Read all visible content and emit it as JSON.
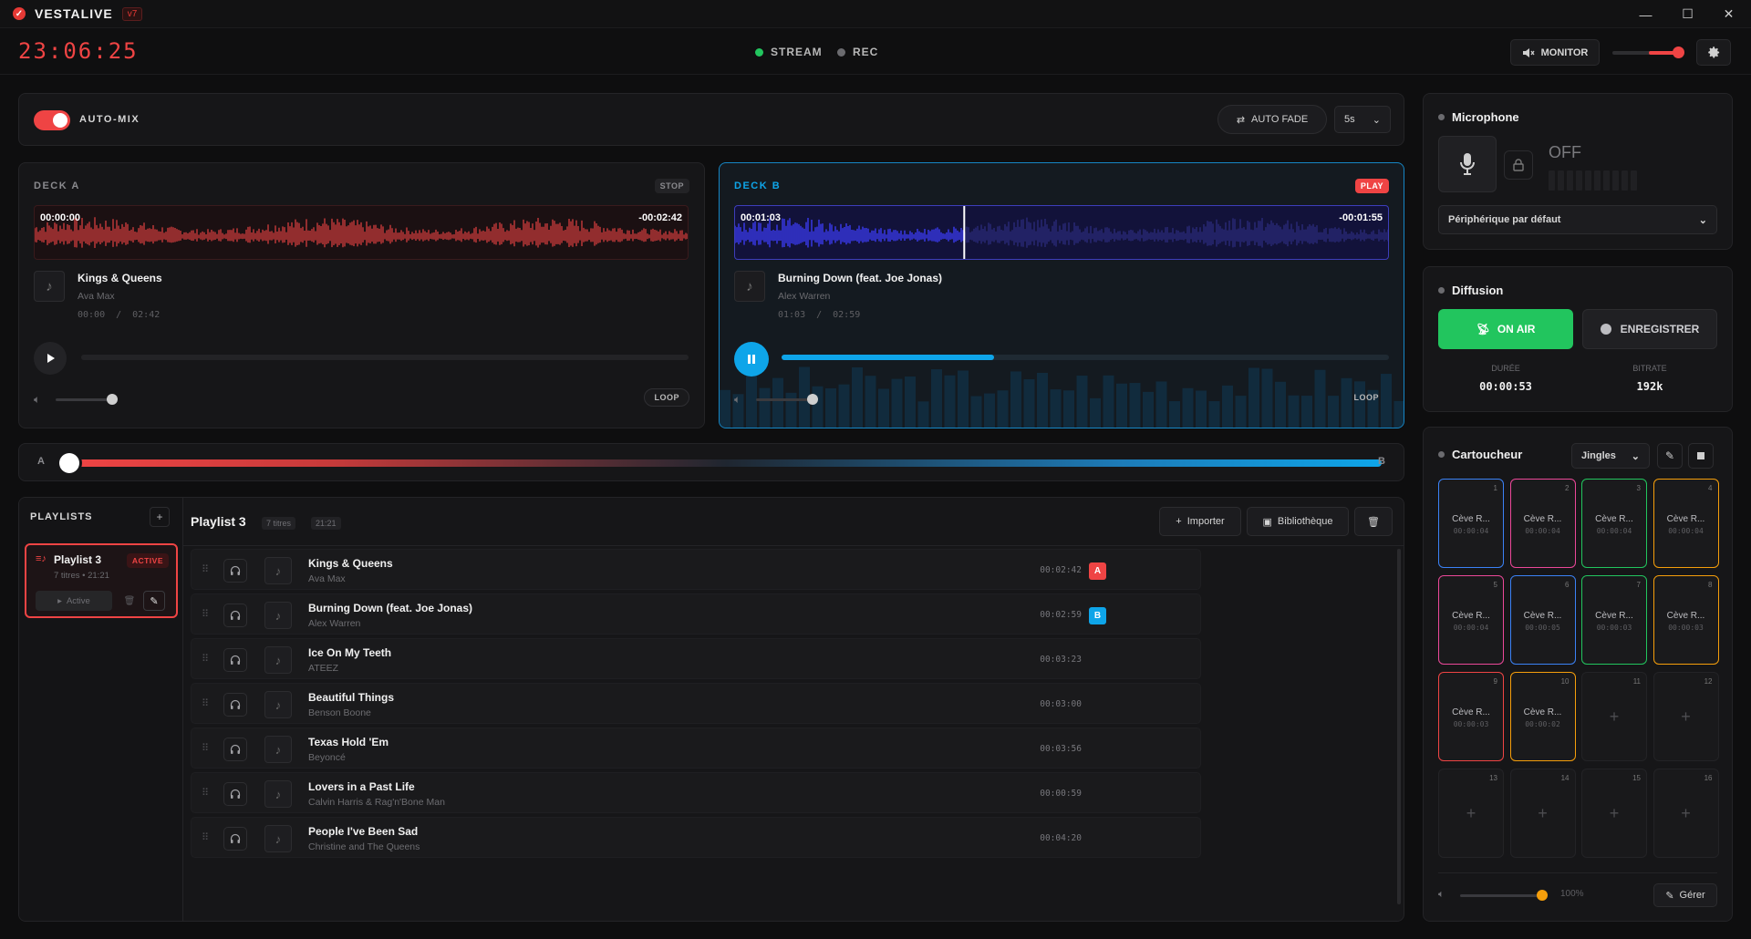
{
  "app": {
    "brand": "VESTALIVE",
    "version": "v7"
  },
  "window": {
    "minimize": "—",
    "maximize": "☐",
    "close": "✕"
  },
  "header": {
    "clock": "23:06:25",
    "stream_label": "STREAM",
    "rec_label": "REC",
    "monitor_label": "MONITOR",
    "monitor_volume": 0.85,
    "colors": {
      "stream_dot": "#22c55e",
      "rec_dot": "#6b6b6f",
      "accent": "#ef4444"
    }
  },
  "automix": {
    "label": "AUTO-MIX",
    "enabled": true,
    "autofade_label": "AUTO FADE",
    "fade_select": "5s"
  },
  "deckA": {
    "title": "DECK A",
    "state": "STOP",
    "elapsed": "00:00:00",
    "remaining": "-00:02:42",
    "track": "Kings & Queens",
    "artist": "Ava Max",
    "pos": "00:00",
    "sep": "/",
    "dur": "02:42",
    "progress": 0.0,
    "volume": 0.5,
    "loop": "LOOP",
    "color": "#ef4444"
  },
  "deckB": {
    "title": "DECK B",
    "state": "PLAY",
    "elapsed": "00:01:03",
    "remaining": "-00:01:55",
    "track": "Burning Down (feat. Joe Jonas)",
    "artist": "Alex Warren",
    "pos": "01:03",
    "sep": "/",
    "dur": "02:59",
    "progress": 0.35,
    "volume": 0.6,
    "loop": "LOOP",
    "color": "#0ea5e9"
  },
  "crossfader": {
    "left": "A",
    "right": "B",
    "position": 0.0
  },
  "playlists": {
    "header": "PLAYLISTS",
    "add": "+",
    "items": [
      {
        "name": "Playlist 3",
        "badge": "ACTIVE",
        "meta": "7 titres  •  21:21",
        "active_btn": "Active"
      }
    ]
  },
  "playlist": {
    "title": "Playlist 3",
    "count_chip": "7 titres",
    "duration_chip": "21:21",
    "import_label": "Importer",
    "library_label": "Bibliothèque",
    "tracks": [
      {
        "title": "Kings & Queens",
        "artist": "Ava Max",
        "duration": "00:02:42",
        "deck": "A"
      },
      {
        "title": "Burning Down (feat. Joe Jonas)",
        "artist": "Alex Warren",
        "duration": "00:02:59",
        "deck": "B"
      },
      {
        "title": "Ice On My Teeth",
        "artist": "ATEEZ",
        "duration": "00:03:23",
        "deck": ""
      },
      {
        "title": "Beautiful Things",
        "artist": "Benson Boone",
        "duration": "00:03:00",
        "deck": ""
      },
      {
        "title": "Texas Hold 'Em",
        "artist": "Beyoncé",
        "duration": "00:03:56",
        "deck": ""
      },
      {
        "title": "Lovers in a Past Life",
        "artist": "Calvin Harris & Rag'n'Bone Man",
        "duration": "00:00:59",
        "deck": ""
      },
      {
        "title": "People I've Been Sad",
        "artist": "Christine and The Queens",
        "duration": "00:04:20",
        "deck": ""
      }
    ]
  },
  "microphone": {
    "title": "Microphone",
    "state": "OFF",
    "device": "Périphérique par défaut"
  },
  "diffusion": {
    "title": "Diffusion",
    "onair": "ON AIR",
    "record": "ENREGISTRER",
    "duration_label": "DURÉE",
    "duration": "00:00:53",
    "bitrate_label": "BITRATE",
    "bitrate": "192k"
  },
  "cartoucheur": {
    "title": "Cartoucheur",
    "select": "Jingles",
    "volume_pct": "100%",
    "manage": "Gérer",
    "carts": [
      {
        "n": "1",
        "title": "Cève R...",
        "dur": "00:00:04",
        "color": "#3b82f6"
      },
      {
        "n": "2",
        "title": "Cève R...",
        "dur": "00:00:04",
        "color": "#ec4899"
      },
      {
        "n": "3",
        "title": "Cève R...",
        "dur": "00:00:04",
        "color": "#22c55e"
      },
      {
        "n": "4",
        "title": "Cève R...",
        "dur": "00:00:04",
        "color": "#f59e0b"
      },
      {
        "n": "5",
        "title": "Cève R...",
        "dur": "00:00:04",
        "color": "#ec4899"
      },
      {
        "n": "6",
        "title": "Cève R...",
        "dur": "00:00:05",
        "color": "#3b82f6"
      },
      {
        "n": "7",
        "title": "Cève R...",
        "dur": "00:00:03",
        "color": "#22c55e"
      },
      {
        "n": "8",
        "title": "Cève R...",
        "dur": "00:00:03",
        "color": "#f59e0b"
      },
      {
        "n": "9",
        "title": "Cève R...",
        "dur": "00:00:03",
        "color": "#ef4444"
      },
      {
        "n": "10",
        "title": "Cève R...",
        "dur": "00:00:02",
        "color": "#f59e0b"
      },
      {
        "n": "11",
        "title": "",
        "dur": "",
        "color": ""
      },
      {
        "n": "12",
        "title": "",
        "dur": "",
        "color": ""
      },
      {
        "n": "13",
        "title": "",
        "dur": "",
        "color": ""
      },
      {
        "n": "14",
        "title": "",
        "dur": "",
        "color": ""
      },
      {
        "n": "15",
        "title": "",
        "dur": "",
        "color": ""
      },
      {
        "n": "16",
        "title": "",
        "dur": "",
        "color": ""
      }
    ]
  }
}
